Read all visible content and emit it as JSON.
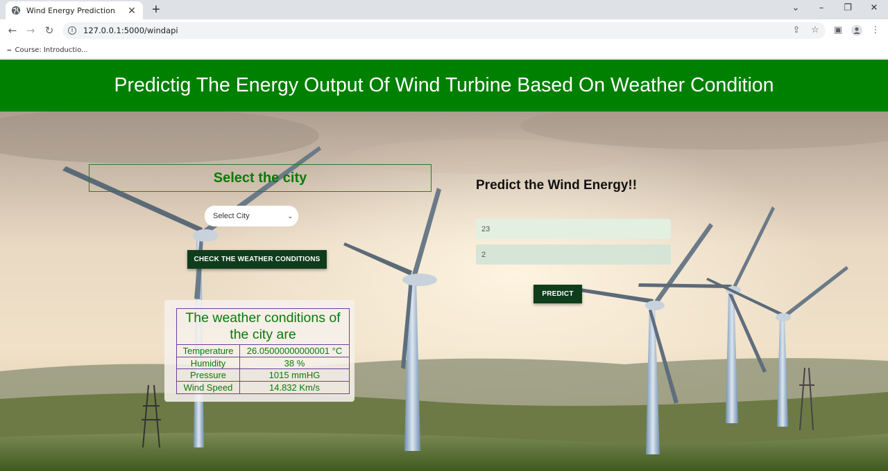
{
  "browser": {
    "tab_title": "Wind Energy Prediction",
    "url": "127.0.0.1:5000/windapi",
    "bookmark": "Course: Introductio..."
  },
  "page": {
    "heading": "Predictig The Energy Output Of Wind Turbine Based On Weather Condition",
    "city_section_title": "Select the city",
    "city_select": "Select City",
    "check_button": "CHECK THE WEATHER CONDITIONS",
    "weather": {
      "title": "The weather conditions of the city are",
      "rows": [
        {
          "label": "Temperature",
          "value": "26.05000000000001 °C"
        },
        {
          "label": "Humidity",
          "value": "38 %"
        },
        {
          "label": "Pressure",
          "value": "1015 mmHG"
        },
        {
          "label": "Wind Speed",
          "value": "14.832 Km/s"
        }
      ]
    },
    "predict_title": "Predict the Wind Energy!!",
    "input1_value": "23",
    "input2_value": "2",
    "predict_button": "PREDICT"
  },
  "colors": {
    "banner": "#008000",
    "green_text": "#0a7a0a",
    "dark_button": "#0f3d1c",
    "table_border": "#6a3ea1"
  }
}
